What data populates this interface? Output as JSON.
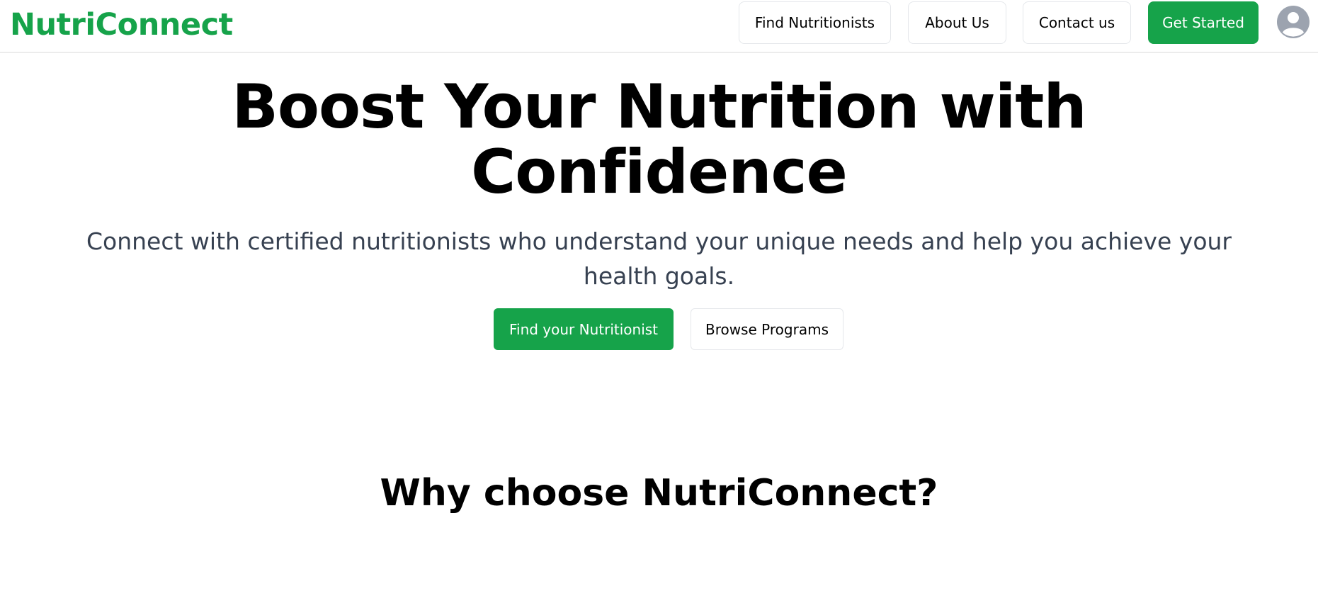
{
  "header": {
    "brand": "NutriConnect",
    "nav": {
      "find_nutritionists": "Find Nutritionists",
      "about_us": "About Us",
      "contact_us": "Contact us",
      "get_started": "Get Started"
    },
    "avatar_icon": "user-avatar-icon"
  },
  "hero": {
    "title_line1": "Boost Your Nutrition with",
    "title_line2": "Confidence",
    "subtitle": "Connect with certified nutritionists who understand your unique needs and help you achieve your health goals.",
    "primary_cta": "Find your Nutritionist",
    "secondary_cta": "Browse Programs"
  },
  "features": {
    "title": "Why choose NutriConnect?"
  },
  "colors": {
    "brand_green": "#16a34a",
    "subtitle_text": "#374151",
    "avatar_gray": "#9ca3af"
  }
}
